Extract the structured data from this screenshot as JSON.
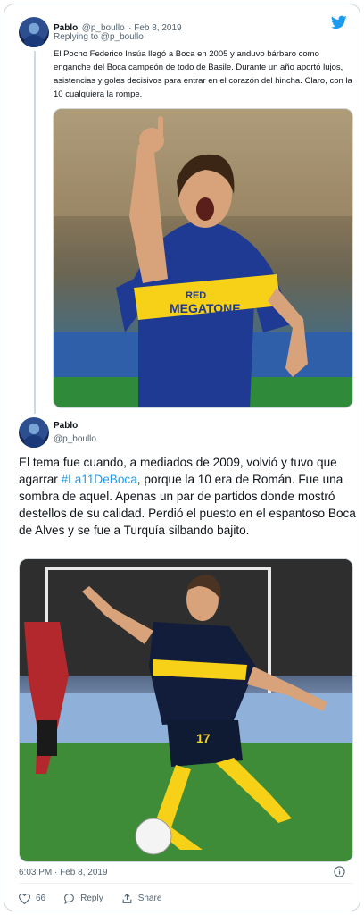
{
  "tweet1": {
    "name": "Pablo",
    "handle": "@p_boullo",
    "date": "Feb 8, 2019",
    "replying_to": "Replying to @p_boullo",
    "text": "El Pocho Federico Insúa llegó a Boca en 2005 y anduvo bárbaro como enganche del Boca campeón de todo de Basile. Durante un año aportó lujos, asistencias y goles decisivos para entrar en el corazón del hincha. Claro, con la 10 cualquiera la rompe.",
    "image": {
      "jersey_text_1": "RED",
      "jersey_text_2": "MEGATONE"
    }
  },
  "tweet2": {
    "name": "Pablo",
    "handle": "@p_boullo",
    "text_before": "El tema fue cuando, a mediados de 2009, volvió y tuvo que agarrar ",
    "hashtag": "#La11DeBoca",
    "text_after": ", porque la 10 era de Román. Fue una sombra de aquel. Apenas un par de partidos donde mostró destellos de su calidad. Perdió el puesto en el espantoso Boca de Alves y se fue a Turquía silbando bajito.",
    "image": {
      "shirt_number": "17"
    }
  },
  "footer": {
    "timestamp": "6:03 PM · Feb 8, 2019",
    "like_count": "66",
    "reply_label": "Reply",
    "share_label": "Share"
  },
  "colors": {
    "accent": "#1d9bf0",
    "like": "#536471",
    "boca_blue": "#1f3a93",
    "boca_yellow": "#f7d117"
  },
  "icons": [
    "twitter-bird-icon",
    "info-icon",
    "heart-icon",
    "reply-icon",
    "share-icon"
  ]
}
